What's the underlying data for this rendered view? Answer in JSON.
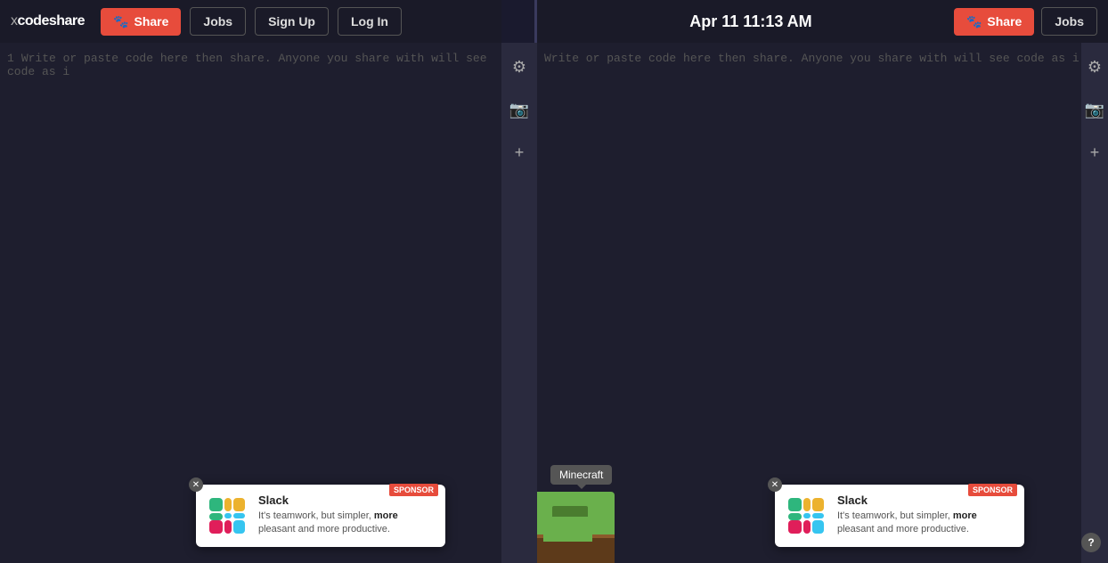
{
  "app": {
    "logo": "xcodeshare",
    "logo_prefix": "x",
    "logo_suffix": "codeshare"
  },
  "navbar": {
    "share_label": "Share",
    "jobs_label": "Jobs",
    "signup_label": "Sign Up",
    "login_label": "Log In"
  },
  "editor": {
    "placeholder": "Write or paste code here then share. Anyone you share with will see code as i",
    "line_number": "1"
  },
  "session": {
    "time": "Apr 11 11:13 AM"
  },
  "right_editor": {
    "placeholder": "Write or paste code here then share. Anyone you share with will see code as i"
  },
  "sidebar": {
    "gear_icon": "⚙",
    "video_icon": "📷",
    "plus_icon": "+"
  },
  "ads": [
    {
      "id": "left-ad",
      "sponsor_label": "SPONSOR",
      "brand": "Slack",
      "description": "It's teamwork, but simpler, more pleasant and more productive."
    },
    {
      "id": "right-ad",
      "sponsor_label": "SPONSOR",
      "brand": "Slack",
      "description": "It's teamwork, but simpler, more pleasant and more productive."
    }
  ],
  "minecraft": {
    "tooltip": "Minecraft"
  },
  "help": {
    "label": "?"
  }
}
